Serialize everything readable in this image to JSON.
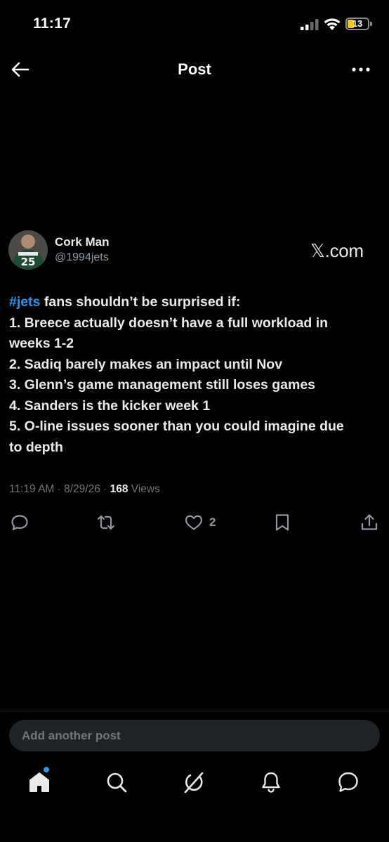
{
  "status_bar": {
    "time": "11:17",
    "battery_level": "13",
    "battery_fraction": 0.13
  },
  "header": {
    "title": "Post"
  },
  "post": {
    "author_name": "Cork Man",
    "author_handle": "@1994jets",
    "source_badge": "𝕏.com",
    "hashtag": "#jets",
    "lines": [
      " fans shouldn’t be surprised if:",
      "1. Breece actually doesn’t have a full workload in",
      "weeks 1-2",
      "2. Sadiq barely makes an impact until Nov",
      "3. Glenn’s game management still loses games",
      "4. Sanders is the kicker week 1",
      "5. O-line issues sooner than you could imagine due",
      "to depth"
    ],
    "timestamp": "11:19 AM · 8/29/26 · ",
    "views_count": "168",
    "views_label": " Views",
    "like_count": "2"
  },
  "composer": {
    "placeholder": "Add another post"
  },
  "icons": {
    "back": "back-arrow-icon",
    "more": "more-dots-icon",
    "reply": "reply-icon",
    "repost": "repost-icon",
    "like": "heart-icon",
    "bookmark": "bookmark-icon",
    "share": "share-icon",
    "home": "home-icon",
    "search": "search-icon",
    "grok": "grok-icon",
    "notifications": "bell-icon",
    "messages": "messages-icon"
  },
  "colors": {
    "background": "#000000",
    "text": "#e7e9ea",
    "secondary": "#71767b",
    "accent": "#1d9bf0",
    "battery": "#f5c518"
  }
}
